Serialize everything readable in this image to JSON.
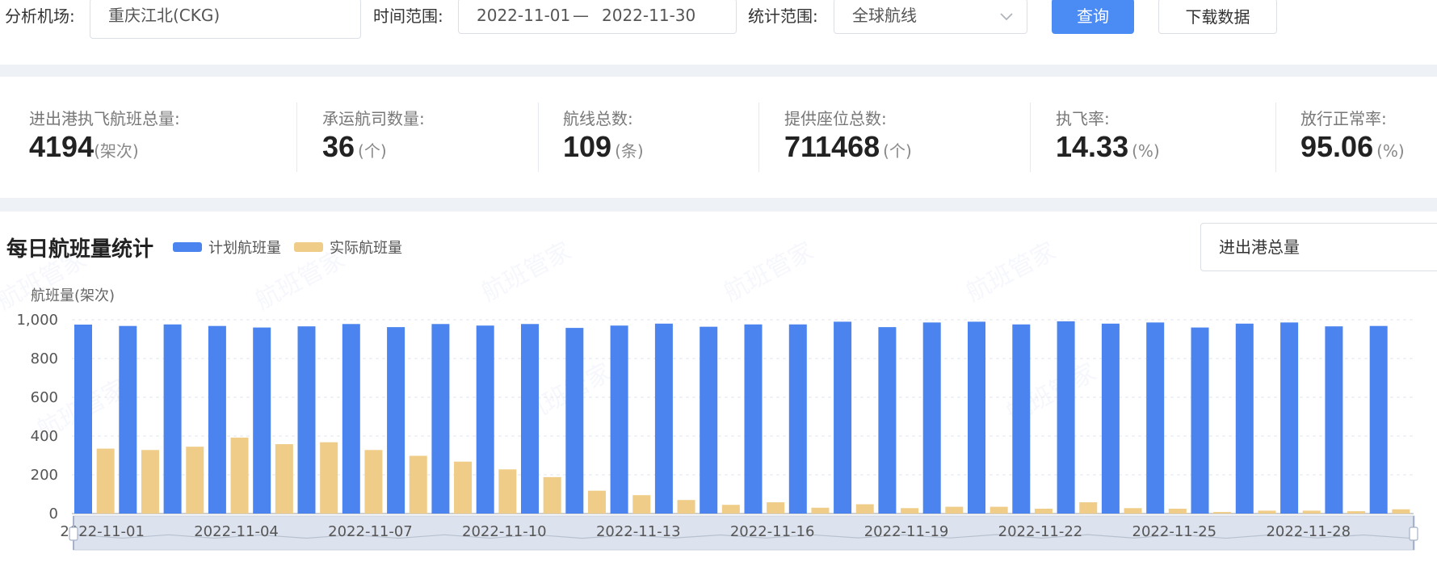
{
  "filters": {
    "airport_label": "分析机场:",
    "airport_value": "重庆江北(CKG)",
    "range_label": "时间范围:",
    "date_start": "2022-11-01",
    "date_sep": "—",
    "date_end": "2022-11-30",
    "scope_label": "统计范围:",
    "scope_value": "全球航线",
    "query_button": "查询",
    "download_button": "下载数据"
  },
  "stats": [
    {
      "label": "进出港执飞航班总量:",
      "value": "4194",
      "unit": "(架次)"
    },
    {
      "label": "承运航司数量:",
      "value": "36",
      "unit": "(个)"
    },
    {
      "label": "航线总数:",
      "value": "109",
      "unit": "(条)"
    },
    {
      "label": "提供座位总数:",
      "value": "711468",
      "unit": "(个)"
    },
    {
      "label": "执飞率:",
      "value": "14.33",
      "unit": "(%)"
    },
    {
      "label": "放行正常率:",
      "value": "95.06",
      "unit": "(%)"
    }
  ],
  "chart_panel": {
    "title": "每日航班量统计",
    "select_value": "进出港总量",
    "watermark_text": "航班管家"
  },
  "colors": {
    "planned": "#4b84ee",
    "actual": "#efcd88",
    "primary_button": "#4b8bf4"
  },
  "icons": {
    "dropdown": "chevron-down-icon",
    "zoom_handle": "drag-handle-icon"
  },
  "chart_data": {
    "type": "bar",
    "title": "每日航班量统计",
    "ylabel": "航班量(架次)",
    "ylim": [
      0,
      1000
    ],
    "yticks": [
      0,
      200,
      400,
      600,
      800,
      1000
    ],
    "ytick_labels": [
      "0",
      "200",
      "400",
      "600",
      "800",
      "1,000"
    ],
    "xtick_labels": [
      "2022-11-01",
      "2022-11-04",
      "2022-11-07",
      "2022-11-10",
      "2022-11-13",
      "2022-11-16",
      "2022-11-19",
      "2022-11-22",
      "2022-11-25",
      "2022-11-28"
    ],
    "categories": [
      "2022-11-01",
      "2022-11-02",
      "2022-11-03",
      "2022-11-04",
      "2022-11-05",
      "2022-11-06",
      "2022-11-07",
      "2022-11-08",
      "2022-11-09",
      "2022-11-10",
      "2022-11-11",
      "2022-11-12",
      "2022-11-13",
      "2022-11-14",
      "2022-11-15",
      "2022-11-16",
      "2022-11-17",
      "2022-11-18",
      "2022-11-19",
      "2022-11-20",
      "2022-11-21",
      "2022-11-22",
      "2022-11-23",
      "2022-11-24",
      "2022-11-25",
      "2022-11-26",
      "2022-11-27",
      "2022-11-28",
      "2022-11-29",
      "2022-11-30"
    ],
    "legend_position": "top-left",
    "grid": true,
    "series": [
      {
        "name": "计划航班量",
        "color": "#4b84ee",
        "values": [
          975,
          968,
          976,
          968,
          960,
          966,
          978,
          962,
          978,
          970,
          978,
          958,
          970,
          980,
          964,
          976,
          976,
          990,
          962,
          986,
          990,
          976,
          992,
          980,
          986,
          960,
          980,
          986,
          966,
          968
        ]
      },
      {
        "name": "实际航班量",
        "color": "#efcd88",
        "values": [
          335,
          328,
          345,
          392,
          358,
          368,
          328,
          298,
          268,
          228,
          188,
          118,
          95,
          70,
          45,
          58,
          30,
          48,
          28,
          35,
          35,
          25,
          58,
          28,
          25,
          8,
          15,
          15,
          12,
          22
        ]
      }
    ]
  }
}
